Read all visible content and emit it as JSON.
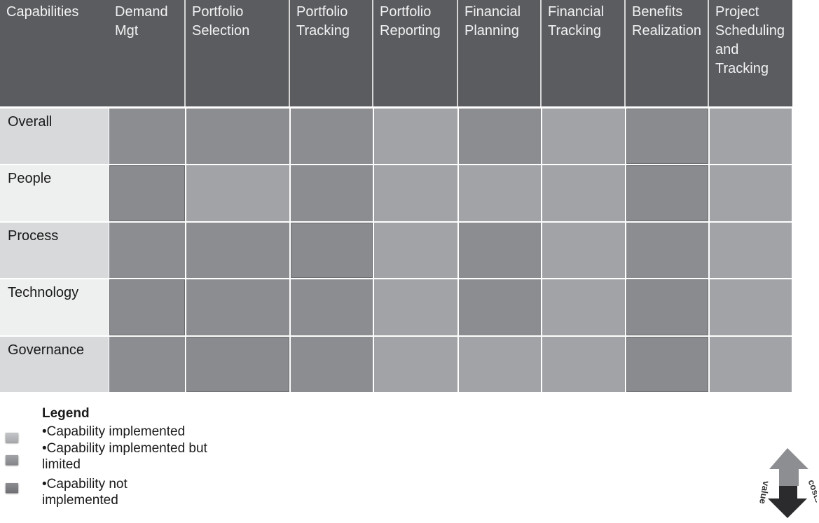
{
  "header": {
    "corner_label": "Capabilities",
    "columns": [
      "Demand\nMgt",
      "Portfolio\nSelection",
      "Portfolio\nTracking",
      "Portfolio\nReporting",
      "Financial\nPlanning",
      "Financial\nTracking",
      "Benefits\nRealization",
      "Project\nScheduling\nand\nTracking"
    ]
  },
  "rows": [
    {
      "label": "Overall",
      "status": [
        "limited",
        "limited",
        "limited",
        "implemented",
        "limited",
        "implemented",
        "not",
        "implemented"
      ]
    },
    {
      "label": "People",
      "status": [
        "not",
        "implemented",
        "limited",
        "implemented",
        "implemented",
        "implemented",
        "not",
        "implemented"
      ]
    },
    {
      "label": "Process",
      "status": [
        "limited",
        "limited",
        "not",
        "implemented",
        "limited",
        "implemented",
        "limited",
        "implemented"
      ]
    },
    {
      "label": "Technology",
      "status": [
        "not",
        "limited",
        "limited",
        "implemented",
        "limited",
        "implemented",
        "not",
        "implemented"
      ]
    },
    {
      "label": "Governance",
      "status": [
        "limited",
        "not",
        "limited",
        "implemented",
        "implemented",
        "implemented",
        "not",
        "implemented"
      ]
    }
  ],
  "legend": {
    "title": "Legend",
    "items": [
      {
        "key": "implemented",
        "label": "•Capability implemented"
      },
      {
        "key": "limited",
        "label": "•Capability implemented but limited"
      },
      {
        "key": "not",
        "label": "•Capability not implemented"
      }
    ]
  },
  "colors": {
    "header_bg": "#5b5c60",
    "implemented": "#a2a3a7",
    "limited": "#8c8d91",
    "not_implemented": "#8a8b8f",
    "row_label_dark": "#d8d9db",
    "row_label_light": "#eef0ef"
  },
  "logo": {
    "top_word": "value",
    "bottom_word": "costs"
  }
}
